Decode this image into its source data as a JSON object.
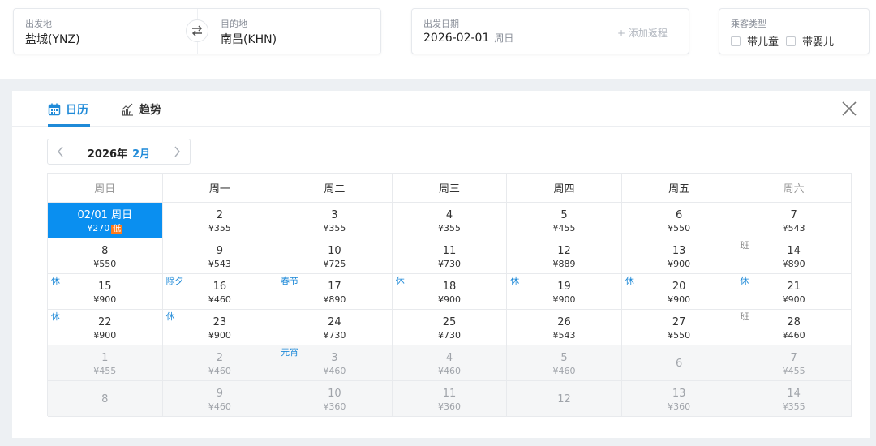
{
  "search": {
    "origin_label": "出发地",
    "origin_value": "盐城(YNZ)",
    "dest_label": "目的地",
    "dest_value": "南昌(KHN)",
    "date_label": "出发日期",
    "date_value": "2026-02-01",
    "date_weekday": "周日",
    "add_return": "+ 添加返程",
    "pax_label": "乘客类型",
    "pax_child": "带儿童",
    "pax_infant": "带婴儿"
  },
  "panel": {
    "tab_calendar": "日历",
    "tab_trend": "趋势",
    "year": "2026年",
    "month": "2月"
  },
  "calendar": {
    "weekdays": [
      "周日",
      "周一",
      "周二",
      "周三",
      "周四",
      "周五",
      "周六"
    ],
    "weeks": [
      [
        {
          "day": "02/01 周日",
          "price": "¥270",
          "low": "低",
          "selected": true
        },
        {
          "day": "2",
          "price": "¥355"
        },
        {
          "day": "3",
          "price": "¥355"
        },
        {
          "day": "4",
          "price": "¥355"
        },
        {
          "day": "5",
          "price": "¥455"
        },
        {
          "day": "6",
          "price": "¥550"
        },
        {
          "day": "7",
          "price": "¥543"
        }
      ],
      [
        {
          "day": "8",
          "price": "¥550"
        },
        {
          "day": "9",
          "price": "¥543"
        },
        {
          "day": "10",
          "price": "¥725"
        },
        {
          "day": "11",
          "price": "¥730"
        },
        {
          "day": "12",
          "price": "¥889"
        },
        {
          "day": "13",
          "price": "¥900"
        },
        {
          "day": "14",
          "price": "¥890",
          "tag": "班",
          "work": true
        }
      ],
      [
        {
          "day": "15",
          "price": "¥900",
          "tag": "休"
        },
        {
          "day": "16",
          "price": "¥460",
          "tag": "除夕"
        },
        {
          "day": "17",
          "price": "¥890",
          "tag": "春节"
        },
        {
          "day": "18",
          "price": "¥900",
          "tag": "休"
        },
        {
          "day": "19",
          "price": "¥900",
          "tag": "休"
        },
        {
          "day": "20",
          "price": "¥900",
          "tag": "休"
        },
        {
          "day": "21",
          "price": "¥900",
          "tag": "休"
        }
      ],
      [
        {
          "day": "22",
          "price": "¥900",
          "tag": "休"
        },
        {
          "day": "23",
          "price": "¥900",
          "tag": "休"
        },
        {
          "day": "24",
          "price": "¥730"
        },
        {
          "day": "25",
          "price": "¥730"
        },
        {
          "day": "26",
          "price": "¥543"
        },
        {
          "day": "27",
          "price": "¥550"
        },
        {
          "day": "28",
          "price": "¥460",
          "tag": "班",
          "work": true
        }
      ],
      [
        {
          "day": "1",
          "price": "¥455",
          "other": true
        },
        {
          "day": "2",
          "price": "¥460",
          "other": true
        },
        {
          "day": "3",
          "price": "¥460",
          "other": true,
          "tag": "元宵"
        },
        {
          "day": "4",
          "price": "¥460",
          "other": true
        },
        {
          "day": "5",
          "price": "¥460",
          "other": true
        },
        {
          "day": "6",
          "price": "",
          "other": true
        },
        {
          "day": "7",
          "price": "¥455",
          "other": true
        }
      ],
      [
        {
          "day": "8",
          "price": "",
          "other": true
        },
        {
          "day": "9",
          "price": "¥460",
          "other": true
        },
        {
          "day": "10",
          "price": "¥360",
          "other": true
        },
        {
          "day": "11",
          "price": "¥360",
          "other": true
        },
        {
          "day": "12",
          "price": "",
          "other": true
        },
        {
          "day": "13",
          "price": "¥360",
          "other": true
        },
        {
          "day": "14",
          "price": "¥355",
          "other": true
        }
      ]
    ]
  },
  "colors": {
    "accent": "#1f8ad8",
    "selected_bg": "#0a8ff0",
    "low_tag": "#ff7a1a"
  },
  "icons": {
    "swap": "swap-arrows-icon",
    "calendar": "calendar-icon",
    "trend": "trend-chart-icon",
    "close": "close-icon",
    "prev": "chevron-left-icon",
    "next": "chevron-right-icon"
  }
}
